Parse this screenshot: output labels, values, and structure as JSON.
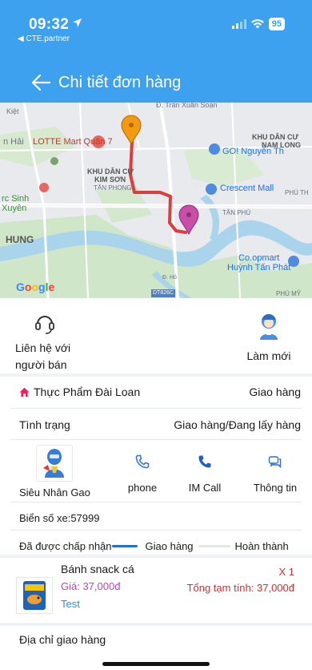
{
  "status_bar": {
    "time": "09:32",
    "back_app": "◀ CTE.partner",
    "battery": "95"
  },
  "header": {
    "title": "Chi tiết đơn hàng"
  },
  "map": {
    "labels": {
      "kiet": "Kiệt",
      "tran_xuan_soan": "Đ. Trần Xuân Soạn",
      "n_hai": "n Hải",
      "lotte": "LOTTE Mart Quận 7",
      "kdc_nam_long_1": "KHU DÂN CƯ",
      "kdc_nam_long_2": "NAM LONG",
      "go_nguyen_thi": "GO! Nguyễn Th",
      "kdc_kim_son_1": "KHU DÂN CƯ",
      "kdc_kim_son_2": "KIM SƠN",
      "tan_phong": "TÂN PHONG",
      "crescent": "Crescent Mall",
      "phu_th": "PHÚ TH",
      "rc_sinh": "rc Sinh",
      "xuyen": "Xuyên",
      "tan_phu": "TÂN PHÚ",
      "hung": "HUNG",
      "coopmart_1": "Co.opmart",
      "coopmart_2": "Huỳnh Tấn Phát",
      "google": "Google",
      "road": "DT826C",
      "phu_my": "PHÚ MỸ",
      "ho": "Đ. Hồ"
    }
  },
  "actions": {
    "contact_label": "Liên hệ với người bán",
    "refresh_label": "Làm mới"
  },
  "order": {
    "shop_name": "Thực Phẩm Đài Loan",
    "delivery_type": "Giao hàng",
    "status_label": "Tình trạng",
    "status_value": "Giao hàng/Đang lấy hàng"
  },
  "driver": {
    "name": "Siêu Nhân Gao",
    "phone_label": "phone",
    "im_call_label": "IM Call",
    "info_label": "Thông tin",
    "plate": "Biển số xe:57999"
  },
  "progress": {
    "steps": [
      "Đã được chấp nhận",
      "Giao hàng",
      "Hoàn thành"
    ],
    "current_step": 1
  },
  "product": {
    "name": "Bánh snack cá",
    "price": "Giá: 37,000đ",
    "note": "Test",
    "quantity": "X 1",
    "subtotal": "Tổng tạm tính: 37,000đ"
  },
  "address": {
    "label": "Địa chỉ giao hàng"
  },
  "colors": {
    "header": "#3da1f0",
    "route": "#e03c3c",
    "origin_pin": "#f29b12",
    "destination_pin": "#c94ea8",
    "price": "#b646c8",
    "accent_blue": "#1f6fd6",
    "total": "#d32f2f"
  }
}
